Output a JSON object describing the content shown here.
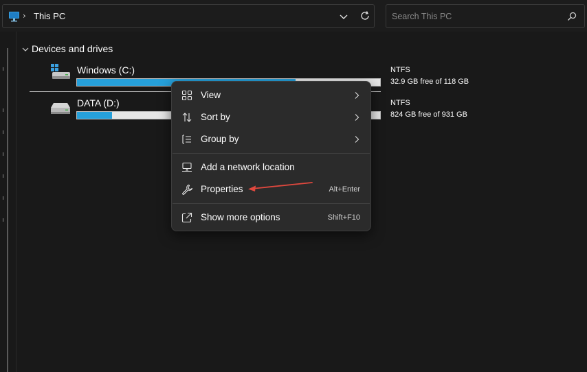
{
  "address_bar": {
    "location_icon": "pc-icon",
    "breadcrumb_separator": "›",
    "breadcrumb": "This PC",
    "dropdown_icon": "chevron-down-icon",
    "refresh_icon": "refresh-icon"
  },
  "search": {
    "placeholder": "Search This PC",
    "value": "",
    "icon": "search-icon"
  },
  "group": {
    "label": "Devices and drives",
    "expanded": true
  },
  "drives": [
    {
      "name": "Windows (C:)",
      "icon": "windows-drive-icon",
      "filesystem": "NTFS",
      "free_text": "32.9 GB free of 118 GB",
      "used_fraction": 0.72,
      "bar_color": "#26a0da"
    },
    {
      "name": "DATA (D:)",
      "icon": "hard-drive-icon",
      "filesystem": "NTFS",
      "free_text": "824 GB free of 931 GB",
      "used_fraction": 0.115,
      "bar_color": "#26a0da"
    }
  ],
  "context_menu": {
    "items": [
      {
        "label": "View",
        "icon": "grid-icon",
        "submenu": true
      },
      {
        "label": "Sort by",
        "icon": "sort-icon",
        "submenu": true
      },
      {
        "label": "Group by",
        "icon": "group-icon",
        "submenu": true
      },
      {
        "label": "Add a network location",
        "icon": "network-location-icon"
      },
      {
        "label": "Properties",
        "icon": "wrench-icon",
        "shortcut": "Alt+Enter"
      },
      {
        "label": "Show more options",
        "icon": "share-icon",
        "shortcut": "Shift+F10"
      }
    ]
  },
  "annotation": {
    "arrow_color": "#e0483e",
    "points_to": "Properties"
  }
}
